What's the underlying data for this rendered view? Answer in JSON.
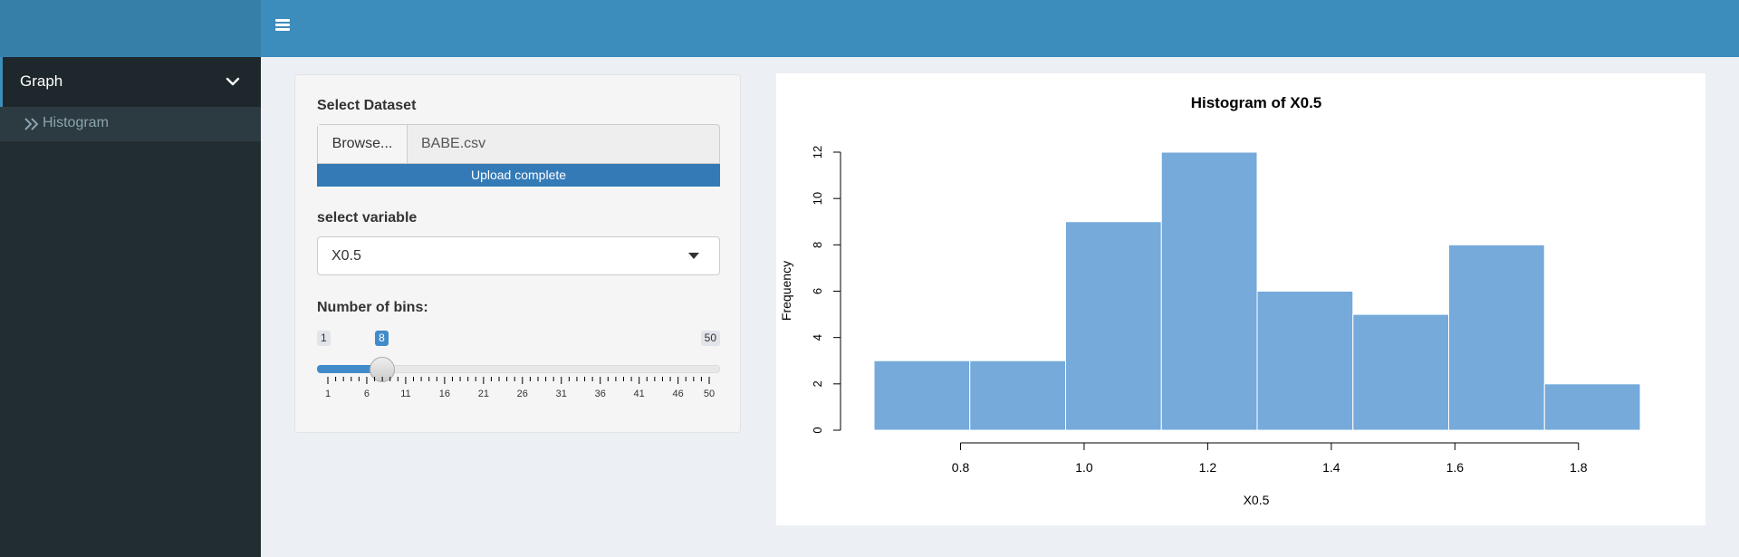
{
  "sidebar": {
    "menu_label": "Graph",
    "submenu_label": "Histogram"
  },
  "panel": {
    "dataset_label": "Select Dataset",
    "browse_label": "Browse...",
    "file_name": "BABE.csv",
    "upload_status": "Upload complete",
    "upload_progress": 1.0,
    "variable_label": "select variable",
    "variable_value": "X0.5",
    "bins_label": "Number of bins:",
    "slider": {
      "min": 1,
      "max": 50,
      "value": 8,
      "min_label": "1",
      "max_label": "50",
      "value_label": "8",
      "tick_labels": [
        "1",
        "6",
        "11",
        "16",
        "21",
        "26",
        "31",
        "36",
        "41",
        "46",
        "50"
      ]
    }
  },
  "colors": {
    "header": "#3c8dbc",
    "sidebar": "#222d32",
    "bar_fill": "#75aadb"
  },
  "chart_data": {
    "type": "bar",
    "title": "Histogram of X0.5",
    "xlabel": "X0.5",
    "ylabel": "Frequency",
    "bins": [
      {
        "start": 0.66,
        "end": 0.815,
        "count": 3
      },
      {
        "start": 0.815,
        "end": 0.97,
        "count": 3
      },
      {
        "start": 0.97,
        "end": 1.125,
        "count": 9
      },
      {
        "start": 1.125,
        "end": 1.28,
        "count": 12
      },
      {
        "start": 1.28,
        "end": 1.435,
        "count": 6
      },
      {
        "start": 1.435,
        "end": 1.59,
        "count": 5
      },
      {
        "start": 1.59,
        "end": 1.745,
        "count": 8
      },
      {
        "start": 1.745,
        "end": 1.9,
        "count": 2
      }
    ],
    "xticks": [
      0.8,
      1.0,
      1.2,
      1.4,
      1.6,
      1.8
    ],
    "xtick_labels": [
      "0.8",
      "1.0",
      "1.2",
      "1.4",
      "1.6",
      "1.8"
    ],
    "yticks": [
      0,
      2,
      4,
      6,
      8,
      10,
      12
    ],
    "ytick_labels": [
      "0",
      "2",
      "4",
      "6",
      "8",
      "10",
      "12"
    ],
    "ylim": [
      0,
      12
    ],
    "grid": false
  }
}
